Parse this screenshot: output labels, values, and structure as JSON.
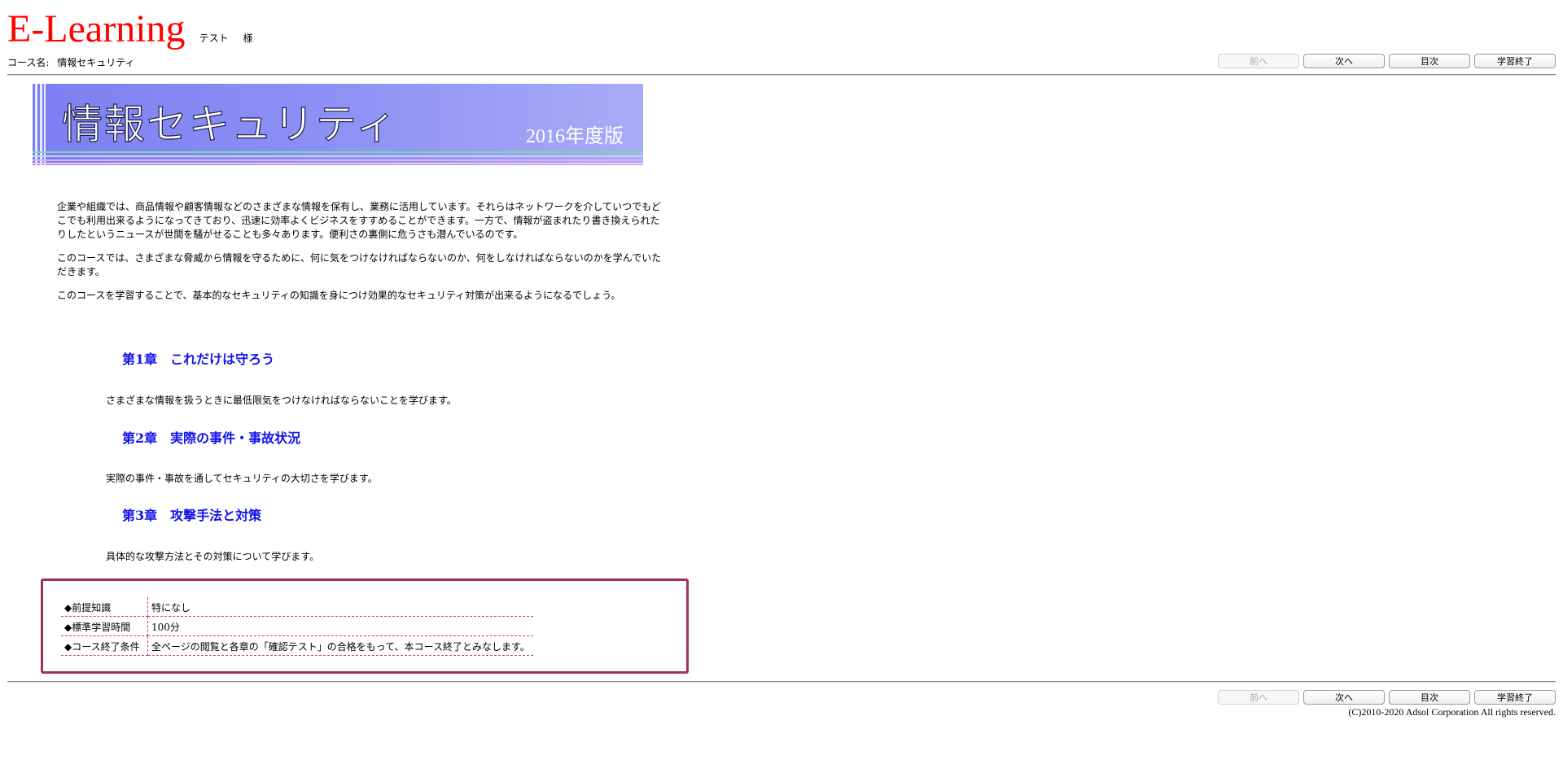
{
  "header": {
    "logo": "E-Learning",
    "user_name": "テスト",
    "user_suffix": "様"
  },
  "course": {
    "label": "コース名:",
    "name": "情報セキュリティ"
  },
  "nav": {
    "prev": "前へ",
    "next": "次へ",
    "toc": "目次",
    "finish": "学習終了"
  },
  "banner": {
    "title": "情報セキュリティ",
    "year": "2016年度版",
    "bg_color": "#8a8df3"
  },
  "intro": {
    "p1": "企業や組織では、商品情報や顧客情報などのさまざまな情報を保有し、業務に活用しています。それらはネットワークを介していつでもどこでも利用出来るようになってきており、迅速に効率よくビジネスをすすめることができます。一方で、情報が盗まれたり書き換えられたりしたというニュースが世間を騒がせることも多々あります。便利さの裏側に危うさも潜んでいるのです。",
    "p2": "このコースでは、さまざまな脅威から情報を守るために、何に気をつけなければならないのか、何をしなければならないのかを学んでいただきます。",
    "p3": "このコースを学習することで、基本的なセキュリティの知識を身につけ効果的なセキュリティ対策が出来るようになるでしょう。"
  },
  "chapters": [
    {
      "title": "第1章　これだけは守ろう",
      "desc": "さまざまな情報を扱うときに最低限気をつけなければならないことを学びます。"
    },
    {
      "title": "第2章　実際の事件・事故状況",
      "desc": "実際の事件・事故を通してセキュリティの大切さを学びます。"
    },
    {
      "title": "第3章　攻撃手法と対策",
      "desc": "具体的な攻撃方法とその対策について学びます。"
    }
  ],
  "info": [
    {
      "label": "◆前提知識",
      "value": "特になし"
    },
    {
      "label": "◆標準学習時間",
      "value": "100分"
    },
    {
      "label": "◆コース終了条件",
      "value": "全ページの閲覧と各章の「確認テスト」の合格をもって、本コース終了とみなします。"
    }
  ],
  "copyright": "(C)2010-2020 Adsol Corporation All rights reserved.",
  "colors": {
    "logo": "#ff0000",
    "chapter_title": "#1111ee",
    "info_border": "#a0305e"
  }
}
